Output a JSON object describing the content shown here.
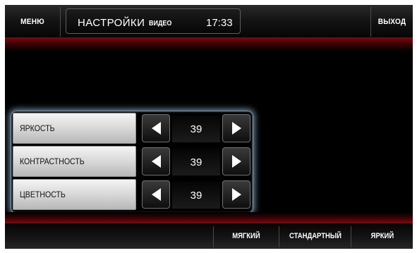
{
  "header": {
    "menu_label": "МЕНЮ",
    "title": "НАСТРОЙКИ",
    "subtitle": "ВИДЕО",
    "time": "17:33",
    "exit_label": "ВЫХОД"
  },
  "settings": [
    {
      "label": "ЯРКОСТЬ",
      "value": "39"
    },
    {
      "label": "КОНТРАСТНОСТЬ",
      "value": "39"
    },
    {
      "label": "ЦВЕТНОСТЬ",
      "value": "39"
    }
  ],
  "presets": {
    "soft_label": "МЯГКИЙ",
    "standard_label": "СТАНДАРТНЫЙ",
    "bright_label": "ЯРКИЙ"
  },
  "icons": {
    "decrease": "triangle-left-icon",
    "increase": "triangle-right-icon"
  },
  "colors": {
    "background": "#000000",
    "accent_red": "#7a0a0f",
    "panel_glow": "#96bedc",
    "text": "#ffffff"
  }
}
